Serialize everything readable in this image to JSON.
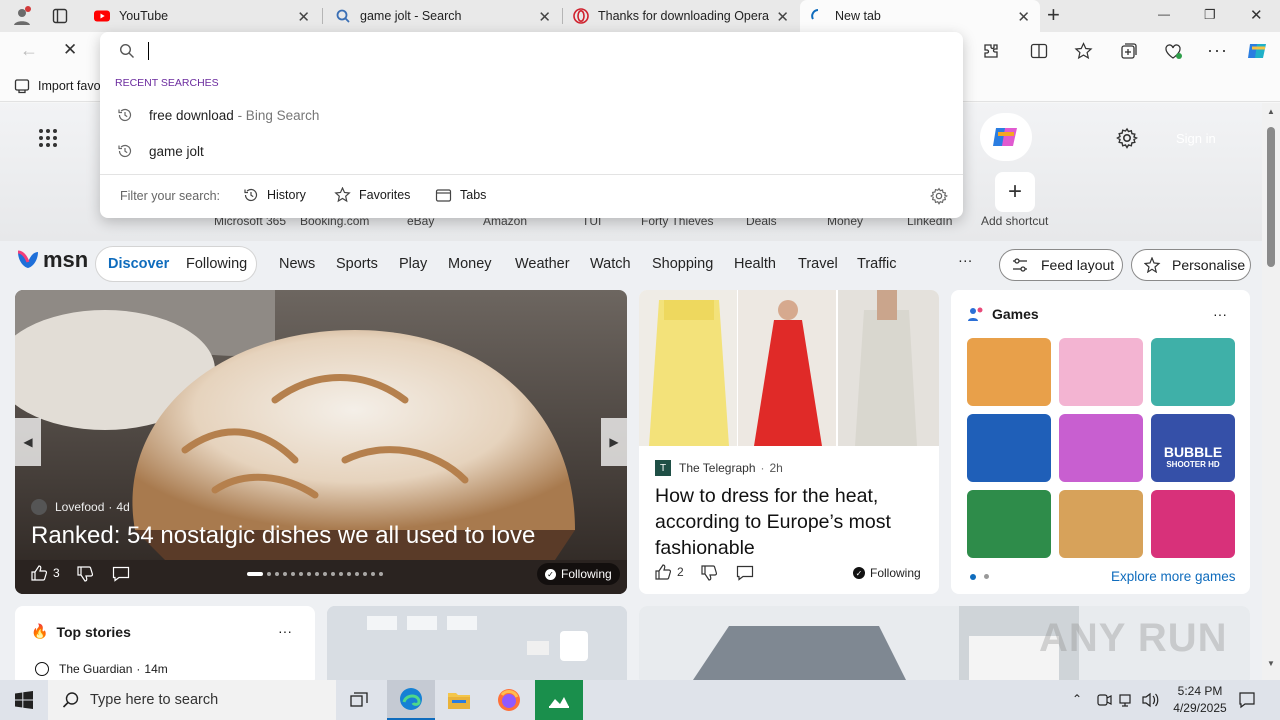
{
  "tabs": [
    {
      "title": "YouTube",
      "close": "✕"
    },
    {
      "title": "game jolt - Search",
      "close": "✕"
    },
    {
      "title": "Thanks for downloading Opera",
      "close": "✕"
    },
    {
      "title": "New tab",
      "close": "✕"
    }
  ],
  "new_tab_glyph": "+",
  "window_controls": {
    "minimize": "—",
    "restore": "❐",
    "close": "✕"
  },
  "toolbar": {
    "stop_glyph": "✕",
    "back_glyph": "←"
  },
  "favorites_bar": {
    "import_label": "Import favo"
  },
  "omnibox": {
    "value": "",
    "recent_label": "RECENT SEARCHES",
    "suggestions": [
      {
        "text": "free download",
        "suffix": " - Bing Search"
      },
      {
        "text": "game jolt",
        "suffix": ""
      }
    ],
    "filter_label": "Filter your search:",
    "filters": [
      "History",
      "Favorites",
      "Tabs"
    ]
  },
  "shortcuts": [
    "Microsoft 365",
    "Booking.com",
    "eBay",
    "Amazon",
    "TUI",
    "Forty Thieves",
    "Deals",
    "Money",
    "LinkedIn"
  ],
  "add_shortcut": "Add shortcut",
  "signin_label": "Sign in",
  "msn": {
    "logo": "msn",
    "pills": [
      "Discover",
      "Following"
    ],
    "nav": [
      "News",
      "Sports",
      "Play",
      "Money",
      "Weather",
      "Watch",
      "Shopping",
      "Health",
      "Travel",
      "Traffic"
    ],
    "more": "···",
    "feed_layout": "Feed layout",
    "personalise": "Personalise"
  },
  "hero_card": {
    "source": "Lovefood",
    "age": "4d",
    "title": "Ranked: 54 nostalgic dishes we all used to love",
    "likes": "3",
    "following": "Following",
    "dots": 16
  },
  "fashion_card": {
    "source": "The Telegraph",
    "age": "2h",
    "title": "How to dress for the heat, according to Europe’s most fashionable",
    "likes": "2",
    "following": "Following"
  },
  "games_card": {
    "title": "Games",
    "more": "···",
    "explore": "Explore more games",
    "tile_colors": [
      "#e8a04a",
      "#f3b4d2",
      "#3fb0a8",
      "#1f5fb8",
      "#c85fd0",
      "#3550a8",
      "#2e8c4a",
      "#d7a25a",
      "#d8317a"
    ],
    "bubble_text": "BUBBLE",
    "shooter_text": "SHOOTER HD"
  },
  "top_stories": {
    "title": "Top stories",
    "more": "···",
    "source": "The Guardian",
    "age": "14m"
  },
  "watermark": "ANY RUN",
  "taskbar": {
    "search_placeholder": "Type here to search",
    "time": "5:24 PM",
    "date": "4/29/2025"
  },
  "colors": {
    "accent": "#0f6cbd",
    "tab_bg": "#e9e9e9",
    "toolbar_bg": "#fbfbfb",
    "youtube_red": "#ff0000",
    "opera_red": "#d0222e"
  }
}
